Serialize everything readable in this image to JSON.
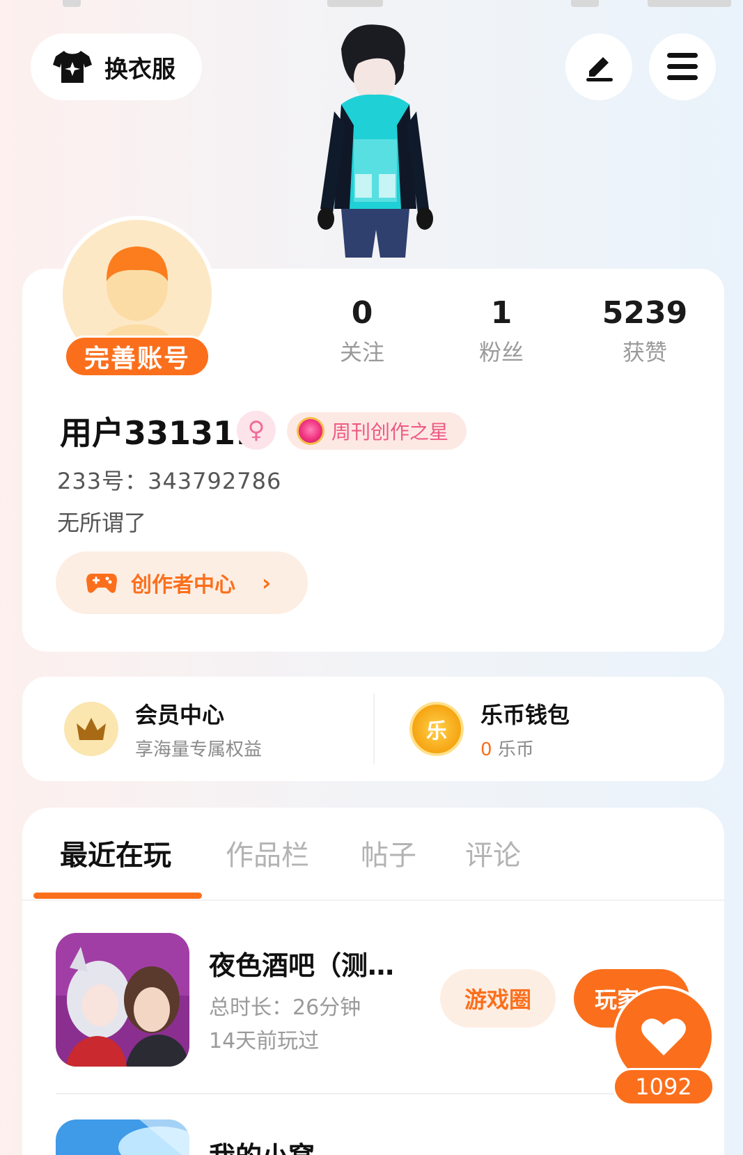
{
  "header": {
    "outfit_label": "换衣服",
    "icons": [
      "shirt-sparkle-icon",
      "edit-icon",
      "menu-icon"
    ]
  },
  "profile": {
    "complete_label": "完善账号",
    "stats": [
      {
        "value": "0",
        "label": "关注"
      },
      {
        "value": "1",
        "label": "粉丝"
      },
      {
        "value": "5239",
        "label": "获赞"
      }
    ],
    "username": "用户331311",
    "gender_symbol": "♀",
    "badge_label": "周刊创作之星",
    "uid": "233号：343792786",
    "bio": "无所谓了",
    "creator_label": "创作者中心",
    "creator_chevron": "›"
  },
  "vip": {
    "member_title": "会员中心",
    "member_sub": "享海量专属权益",
    "wallet_title": "乐币钱包",
    "wallet_amount": "0",
    "wallet_unit": "乐币",
    "wallet_icon_char": "乐"
  },
  "tabs": [
    {
      "label": "最近在玩",
      "active": true
    },
    {
      "label": "作品栏",
      "active": false
    },
    {
      "label": "帖子",
      "active": false
    },
    {
      "label": "评论",
      "active": false
    }
  ],
  "games": [
    {
      "title": "夜色酒吧（测…",
      "duration": "总时长：26分钟",
      "last_played": "14天前玩过",
      "circle_label": "游戏圈",
      "play_label": "玩家"
    },
    {
      "title": "我的小窝"
    }
  ],
  "like_fab": {
    "count": "1092"
  },
  "colors": {
    "accent": "#fb6f1c",
    "badge_pink": "#ee5a84",
    "tab_inactive": "#b3b3b3"
  }
}
